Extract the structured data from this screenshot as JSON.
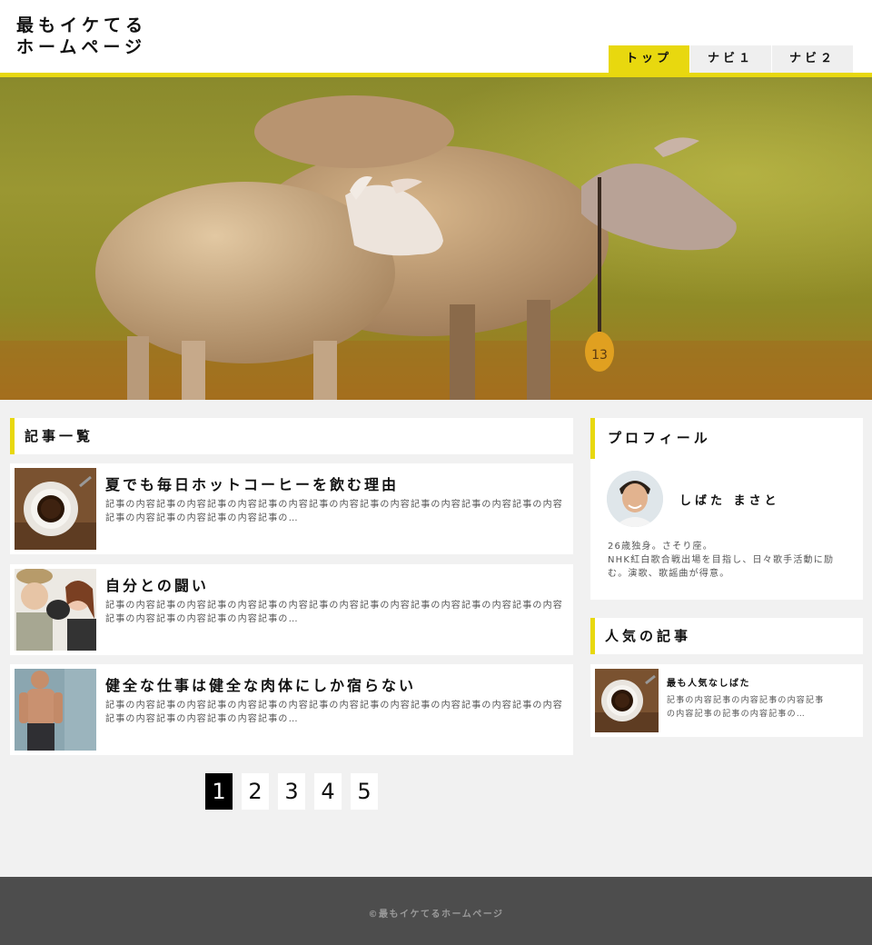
{
  "header": {
    "logo_line1": "最もイケてる",
    "logo_line2": "ホームページ"
  },
  "nav": [
    {
      "label": "トップ",
      "active": true
    },
    {
      "label": "ナビ１"
    },
    {
      "label": "ナビ２"
    }
  ],
  "colors": {
    "accent": "#e8d80f",
    "background": "#f1f1f1",
    "footer": "#4d4d4d"
  },
  "hero": {
    "icon": "sheep-photo",
    "tag_text": "13"
  },
  "main": {
    "heading": "記事一覧",
    "articles": [
      {
        "title": "夏でも毎日ホットコーヒーを飲む理由",
        "excerpt": "記事の内容記事の内容記事の内容記事の内容記事の内容記事の内容記事の内容記事の内容記事の内容記事の内容記事の内容記事の内容記事の…",
        "thumb": "coffee-photo"
      },
      {
        "title": "自分との闘い",
        "excerpt": "記事の内容記事の内容記事の内容記事の内容記事の内容記事の内容記事の内容記事の内容記事の内容記事の内容記事の内容記事の内容記事の…",
        "thumb": "boxing-couple-photo"
      },
      {
        "title": "健全な仕事は健全な肉体にしか宿らない",
        "excerpt": "記事の内容記事の内容記事の内容記事の内容記事の内容記事の内容記事の内容記事の内容記事の内容記事の内容記事の内容記事の内容記事の…",
        "thumb": "fitness-man-photo"
      }
    ],
    "pagination": [
      {
        "label": "1",
        "active": true
      },
      {
        "label": "2"
      },
      {
        "label": "3"
      },
      {
        "label": "4"
      },
      {
        "label": "5"
      }
    ]
  },
  "sidebar": {
    "profile": {
      "heading": "プロフィール",
      "name": "しばた まさと",
      "bio_line1": "26歳独身。さそり座。",
      "bio_line2": "NHK紅白歌合戦出場を目指し、日々歌手活動に励む。演歌、歌謡曲が得意。"
    },
    "popular": {
      "heading": "人気の記事",
      "item": {
        "title": "最も人気なしばた",
        "excerpt": "記事の内容記事の内容記事の内容記事の内容記事の記事の内容記事の…",
        "thumb": "coffee-photo"
      }
    }
  },
  "footer": {
    "copyright": "©最もイケてるホームページ"
  }
}
